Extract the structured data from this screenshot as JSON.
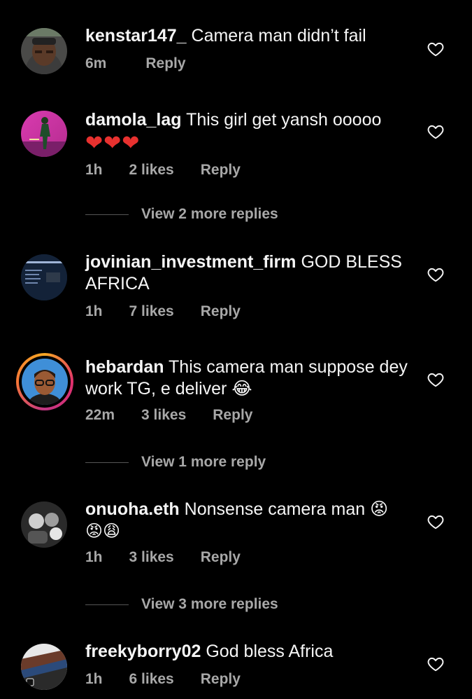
{
  "comments": [
    {
      "username": "kenstar147_",
      "text": "Camera man didn’t fail",
      "time": "6m",
      "likes": "",
      "reply": "Reply"
    },
    {
      "username": "damola_lag",
      "text": "This girl get yansh ooooo",
      "extra": "❤❤❤",
      "time": "1h",
      "likes": "2 likes",
      "reply": "Reply",
      "view_more": "View 2 more replies"
    },
    {
      "username": "jovinian_investment_firm",
      "text": "GOD BLESS AFRICA",
      "time": "1h",
      "likes": "7 likes",
      "reply": "Reply"
    },
    {
      "username": "hebardan",
      "text": "This camera man suppose dey work TG, e deliver 😂",
      "time": "22m",
      "likes": "3 likes",
      "reply": "Reply",
      "view_more": "View 1 more reply"
    },
    {
      "username": "onuoha.eth",
      "text": "Nonsense camera man 😡",
      "extra": "😡😩",
      "time": "1h",
      "likes": "3 likes",
      "reply": "Reply",
      "view_more": "View 3 more replies"
    },
    {
      "username": "freekyborry02",
      "text": "God bless Africa",
      "time": "1h",
      "likes": "6 likes",
      "reply": "Reply"
    }
  ],
  "colors": {
    "background": "#000000",
    "text": "#f5f5f5",
    "meta": "#a8a8a8",
    "heart_emoji": "#e8312f"
  },
  "icons": {
    "like": "heart-outline-icon"
  }
}
